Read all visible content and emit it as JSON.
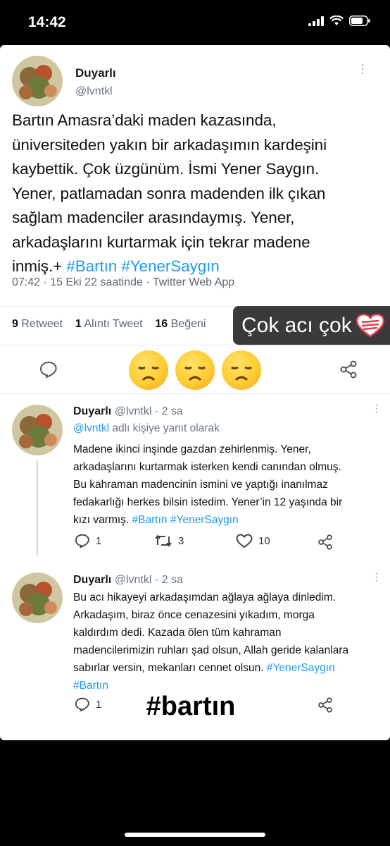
{
  "status_bar": {
    "time": "14:42"
  },
  "main_tweet": {
    "display_name": "Duyarlı",
    "handle": "@lvntkl",
    "text_lines": [
      "Bartın Amasra’daki maden kazasında,",
      "üniversiteden yakın bir arkadaşımın kardeşini",
      "kaybettik. Çok üzgünüm. İsmi Yener Saygın.",
      "Yener, patlamadan sonra madenden ilk çıkan",
      "sağlam madenciler arasındaymış. Yener,",
      "arkadaşlarını kurtarmak için tekrar madene"
    ],
    "last_line_text": "inmiş.+",
    "hashtags": "#Bartın #YenerSaygın",
    "meta": "07:42 · 15 Eki 22 saatinde · Twitter Web App",
    "stats": {
      "retweet_count": "9",
      "retweet_label": "Retweet",
      "quote_count": "1",
      "quote_label": "Alıntı Tweet",
      "like_count": "16",
      "like_label": "Beğeni"
    }
  },
  "sticker_text": "Çok acı çok",
  "reply1": {
    "display_name": "Duyarlı",
    "handle_time": "@lvntkl · 2 sa",
    "reply_to_handle": "@lvntkl",
    "reply_to_label": "adlı kişiye yanıt olarak",
    "text_lines": [
      "Madene ikinci inşinde gazdan zehirlenmiş. Yener,",
      "arkadaşlarını kurtarmak isterken kendi canından olmuş.",
      "Bu kahraman madencinin ismini ve yaptığı inanılmaz",
      "fedakarlığı herkes bilsin istedim. Yener’in 12 yaşında bir"
    ],
    "last_line_text": "kızı varmış.",
    "hashtags": "#Bartın #YenerSaygın",
    "reply_count": "1",
    "retweet_count": "3",
    "like_count": "10"
  },
  "reply2": {
    "display_name": "Duyarlı",
    "handle_time": "@lvntkl · 2 sa",
    "text_lines": [
      "Bu acı hikayeyi arkadaşımdan ağlaya ağlaya dinledim.",
      "Arkadaşım, biraz önce cenazesini yıkadım, morga",
      "kaldırdım dedi. Kazada ölen tüm kahraman",
      "madencilerimizin ruhları şad olsun, Allah geride kalanlara"
    ],
    "last_line_text": "sabırlar versin, mekanları cennet olsun.",
    "last_line_tag": "#YenerSaygın",
    "hashtag_line": "#Bartın",
    "reply_count": "1"
  },
  "hashtag_sticker": "#bartın",
  "colors": {
    "link": "#1d9bf0",
    "sticker_bg": "#3a3a3a"
  }
}
